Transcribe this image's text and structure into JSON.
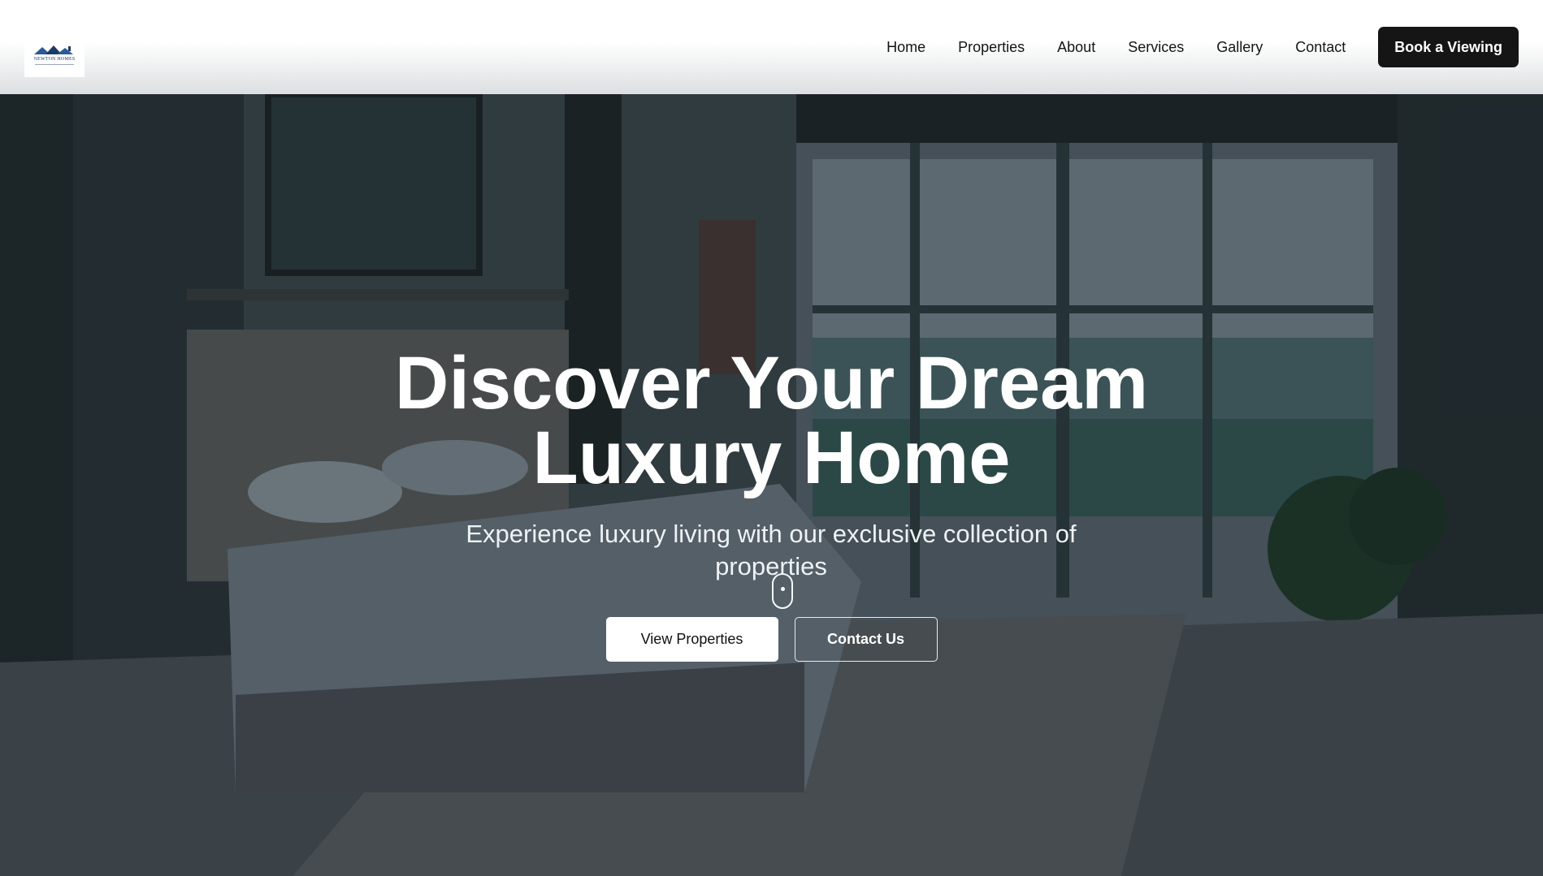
{
  "header": {
    "logo_text": "NEWTON HOMES",
    "nav": [
      "Home",
      "Properties",
      "About",
      "Services",
      "Gallery",
      "Contact"
    ],
    "cta_label": "Book a Viewing"
  },
  "hero": {
    "title_line1": "Discover Your Dream",
    "title_line2": "Luxury Home",
    "subtitle": "Experience luxury living with our exclusive collection of properties",
    "primary_button": "View Properties",
    "secondary_button": "Contact Us"
  },
  "colors": {
    "header_bg": "#ffffff",
    "cta_bg": "#151515",
    "hero_text": "#ffffff",
    "logo_blue": "#1d3a66"
  }
}
